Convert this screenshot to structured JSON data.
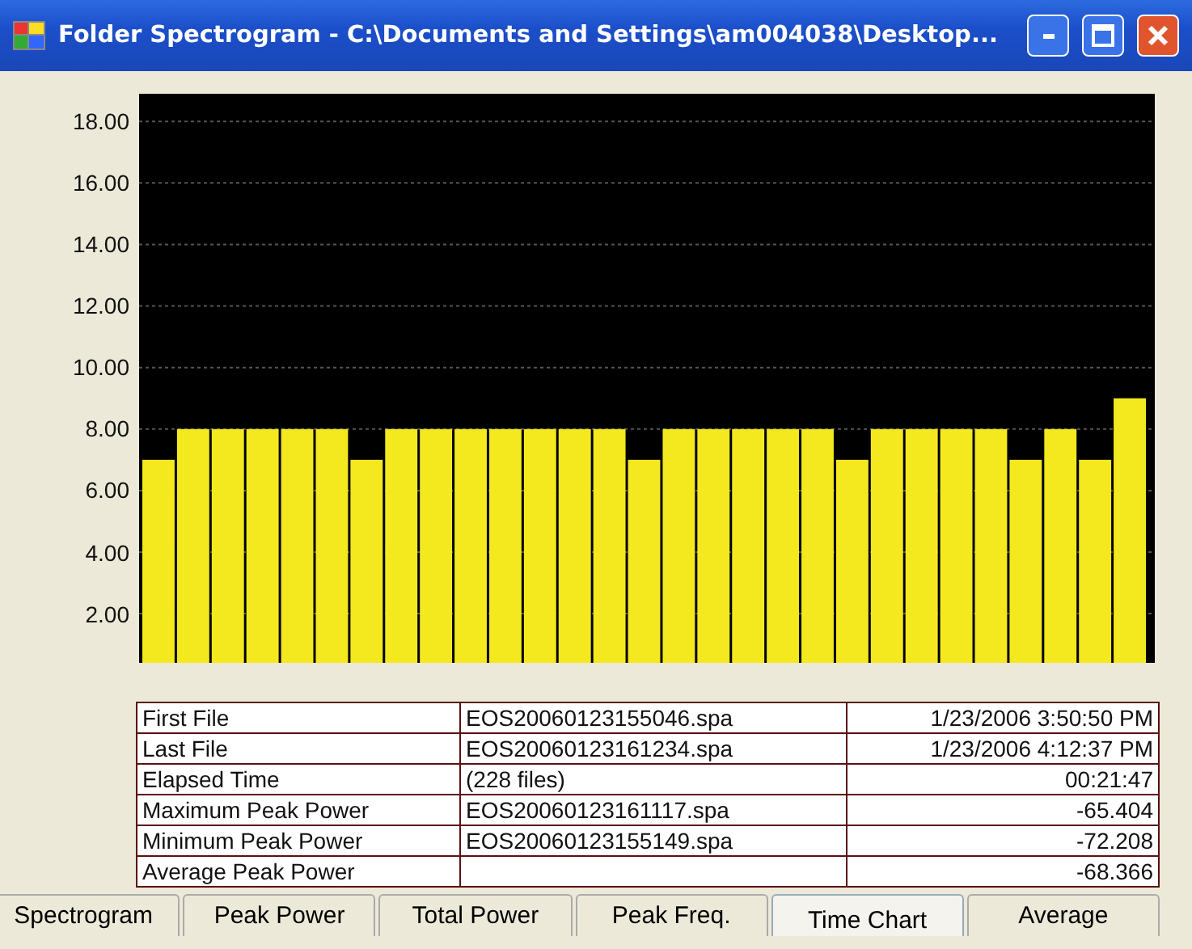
{
  "window": {
    "title": "Folder Spectrogram - C:\\Documents and Settings\\am004038\\Desktop..."
  },
  "chart": {
    "chart_data": {
      "type": "bar",
      "grid": true,
      "values": [
        7,
        8,
        8,
        8,
        8,
        8,
        7,
        8,
        8,
        8,
        8,
        8,
        8,
        8,
        7,
        8,
        8,
        8,
        8,
        8,
        7,
        8,
        8,
        8,
        8,
        7,
        8,
        7,
        9
      ],
      "ylim": [
        0.4,
        18.9
      ],
      "yticks": [
        {
          "value": 2,
          "label": "2.00"
        },
        {
          "value": 4,
          "label": "4.00"
        },
        {
          "value": 6,
          "label": "6.00"
        },
        {
          "value": 8,
          "label": "8.00"
        },
        {
          "value": 10,
          "label": "10.00"
        },
        {
          "value": 12,
          "label": "12.00"
        },
        {
          "value": 14,
          "label": "14.00"
        },
        {
          "value": 16,
          "label": "16.00"
        },
        {
          "value": 18,
          "label": "18.00"
        }
      ]
    }
  },
  "table": {
    "rows": [
      {
        "label": "First File",
        "file": "EOS20060123155046.spa",
        "value": "1/23/2006 3:50:50 PM"
      },
      {
        "label": "Last File",
        "file": "EOS20060123161234.spa",
        "value": "1/23/2006 4:12:37 PM"
      },
      {
        "label": "Elapsed Time",
        "file": "(228 files)",
        "value": "00:21:47"
      },
      {
        "label": "Maximum Peak Power",
        "file": "EOS20060123161117.spa",
        "value": "-65.404"
      },
      {
        "label": "Minimum Peak Power",
        "file": "EOS20060123155149.spa",
        "value": "-72.208"
      },
      {
        "label": "Average Peak Power",
        "value": "-68.366"
      }
    ]
  },
  "tabs": [
    {
      "label": "Spectrogram",
      "selected": false
    },
    {
      "label": "Peak Power",
      "selected": false
    },
    {
      "label": "Total Power",
      "selected": false
    },
    {
      "label": "Peak Freq.",
      "selected": false
    },
    {
      "label": "Time Chart",
      "selected": true
    },
    {
      "label": "Average",
      "selected": false
    }
  ]
}
